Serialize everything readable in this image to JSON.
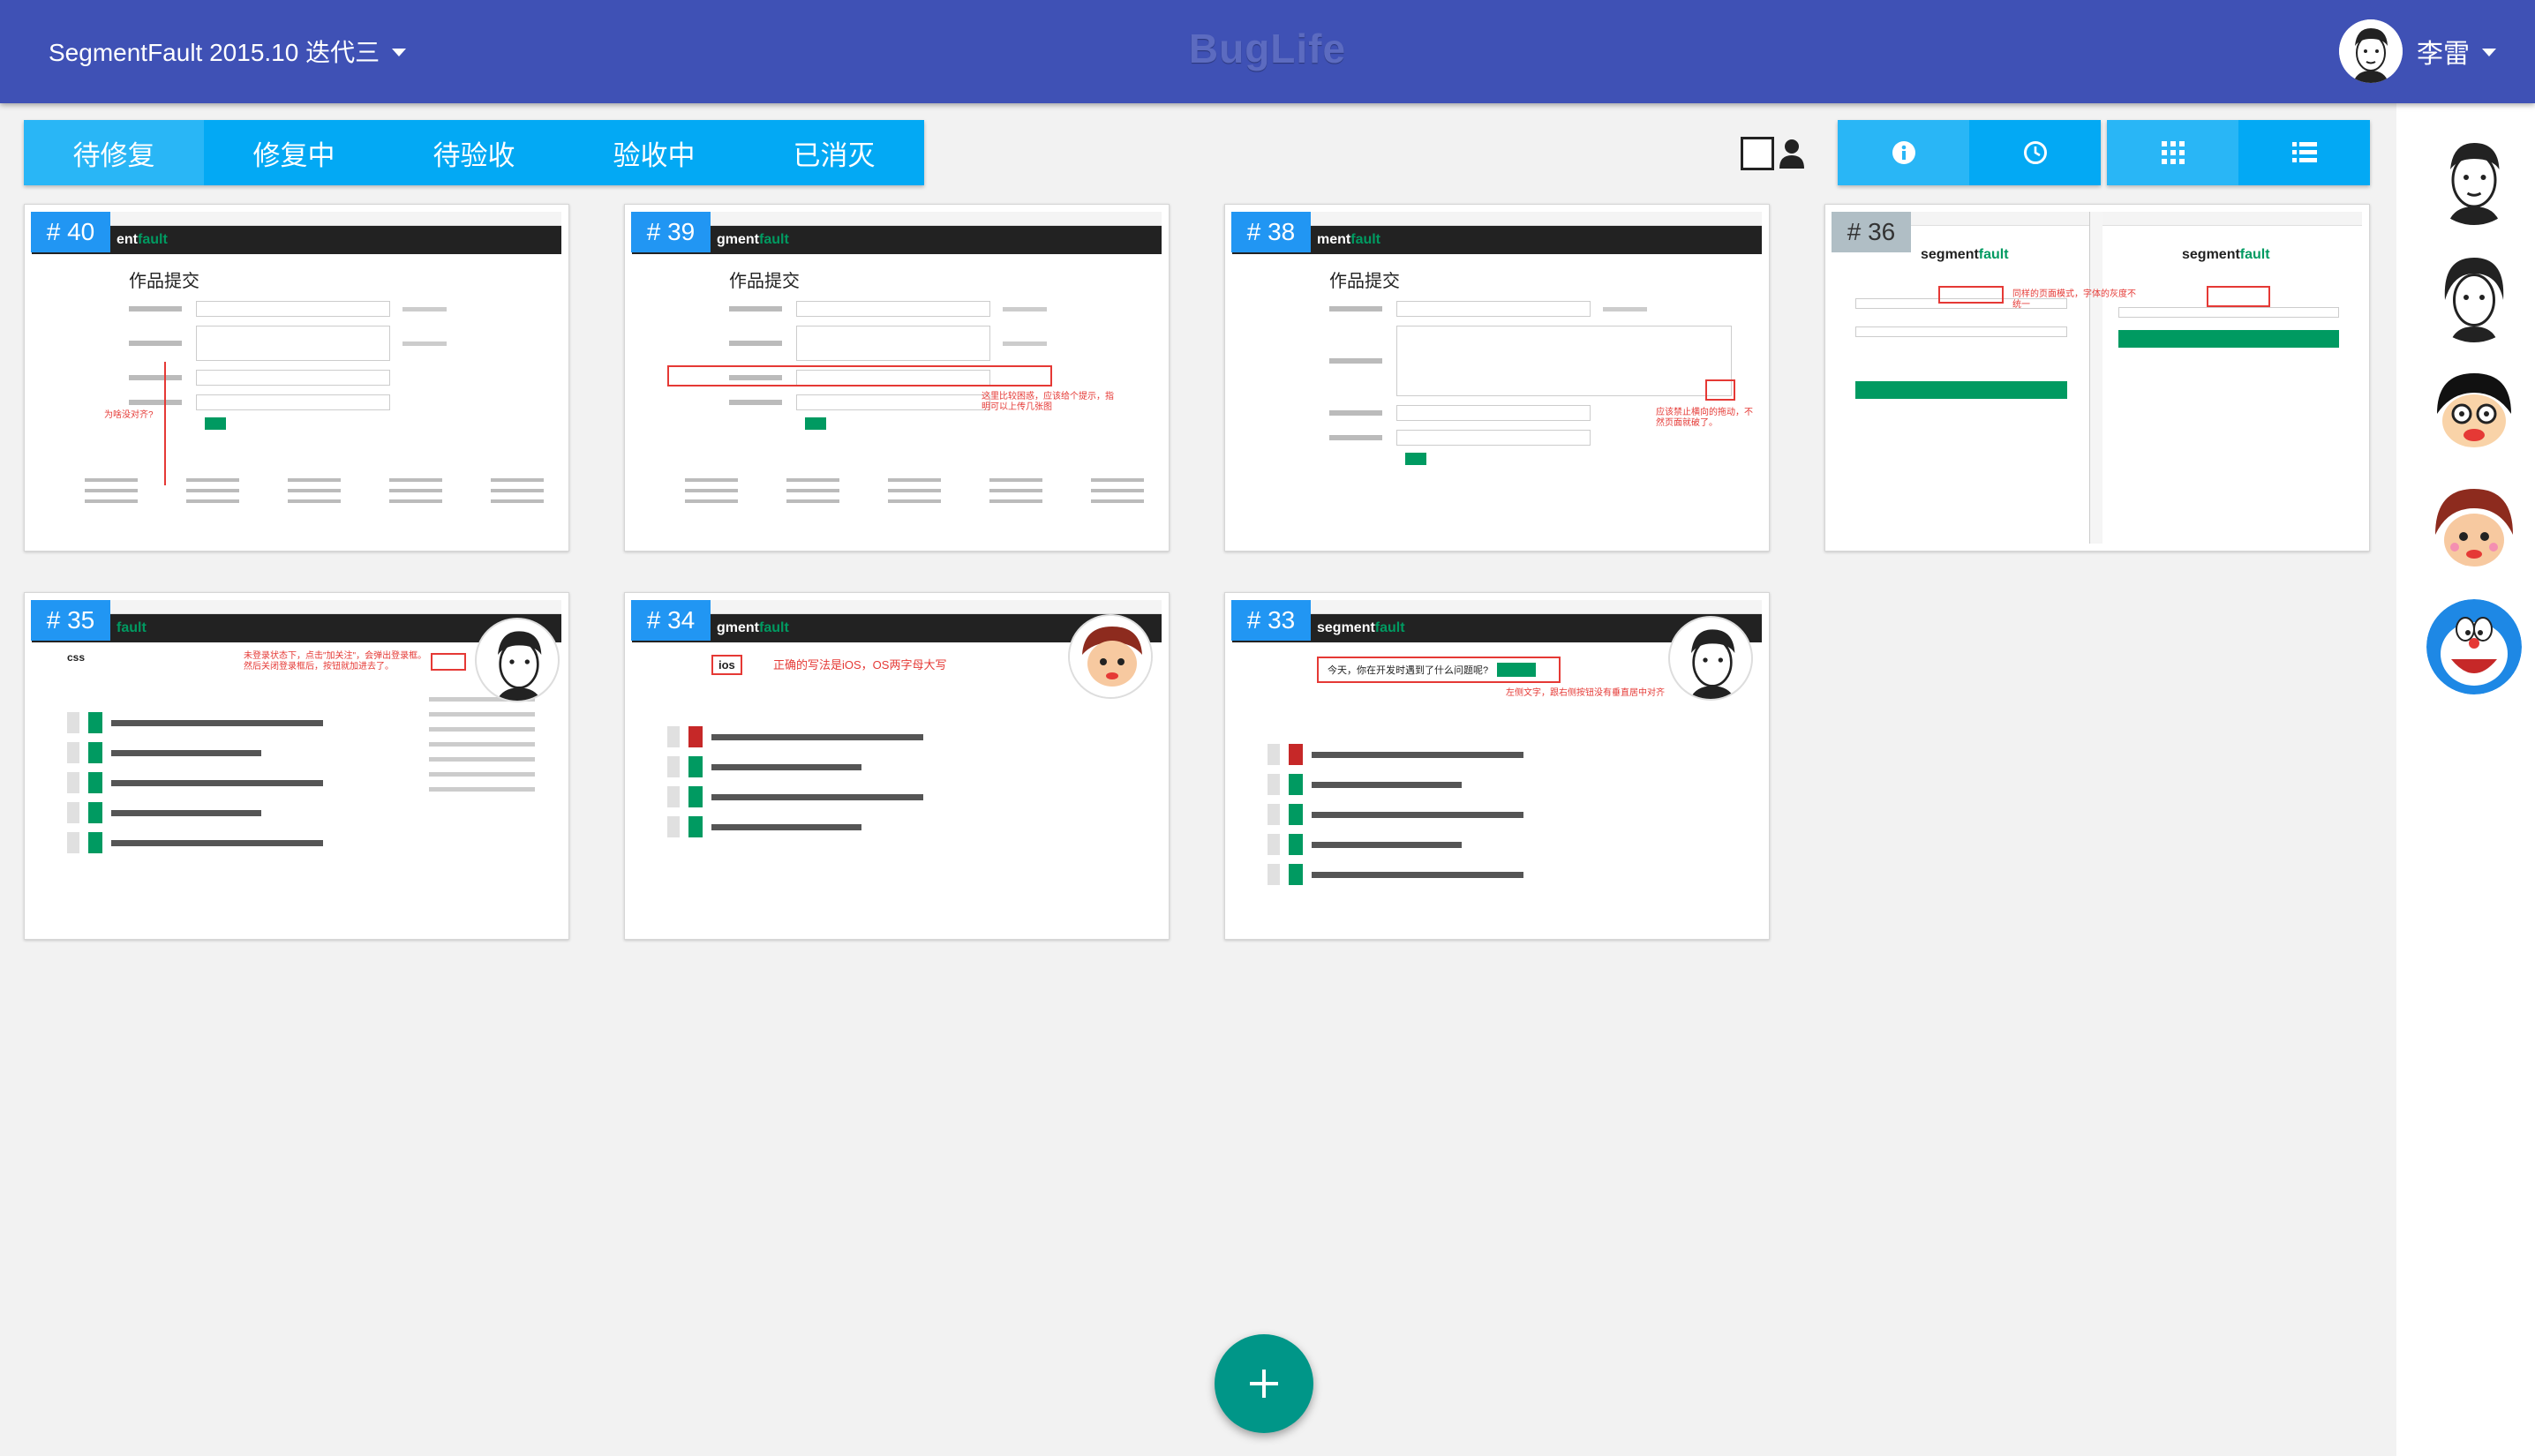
{
  "header": {
    "project_name": "SegmentFault 2015.10 迭代三",
    "app_title": "BugLife",
    "user_name": "李雷"
  },
  "status_tabs": [
    "待修复",
    "修复中",
    "待验收",
    "验收中",
    "已消灭"
  ],
  "toolbar": {
    "checkbox_icon": "checkbox-icon",
    "person_icon": "person-icon",
    "info_icon": "info-icon",
    "clock_icon": "clock-icon",
    "grid_icon": "grid-view-icon",
    "list_icon": "list-view-icon"
  },
  "bugs": [
    {
      "id": "# 40",
      "logo_seg": "ent",
      "logo_fault": "fault",
      "heading": "作品提交",
      "annotation": "为啥没对齐?"
    },
    {
      "id": "# 39",
      "logo_seg": "gment",
      "logo_fault": "fault",
      "heading": "作品提交",
      "annotation": "这里比较困惑，应该给个提示，指明可以上传几张图"
    },
    {
      "id": "# 38",
      "logo_seg": "ment",
      "logo_fault": "fault",
      "heading": "作品提交",
      "annotation": "应该禁止横向的拖动，不然页面就破了。"
    },
    {
      "id": "# 36",
      "logo_seg": "segment",
      "logo_fault": "fault",
      "heading": "",
      "annotation": "同样的页面模式，字体的灰度不统一"
    },
    {
      "id": "# 35",
      "logo_seg": "",
      "logo_fault": "fault",
      "heading": "css",
      "annotation": "未登录状态下，点击\"加关注\"，会弹出登录框。然后关闭登录框后，按钮就加进去了。"
    },
    {
      "id": "# 34",
      "logo_seg": "gment",
      "logo_fault": "fault",
      "heading": "ios",
      "annotation": "正确的写法是iOS，OS两字母大写"
    },
    {
      "id": "# 33",
      "logo_seg": "segment",
      "logo_fault": "fault",
      "heading": "今天，你在开发时遇到了什么问题呢?",
      "annotation": "左侧文字，跟右侧按钮没有垂直居中对齐"
    }
  ],
  "members": [
    "member-avatar-1",
    "member-avatar-2",
    "member-avatar-3",
    "member-avatar-4",
    "member-avatar-5"
  ],
  "fab": {
    "icon": "plus-icon"
  },
  "colors": {
    "header": "#3f51b5",
    "tabs": "#03a9f4",
    "tab_active": "#29b6f6",
    "badge": "#2196f3",
    "fab": "#009688"
  }
}
